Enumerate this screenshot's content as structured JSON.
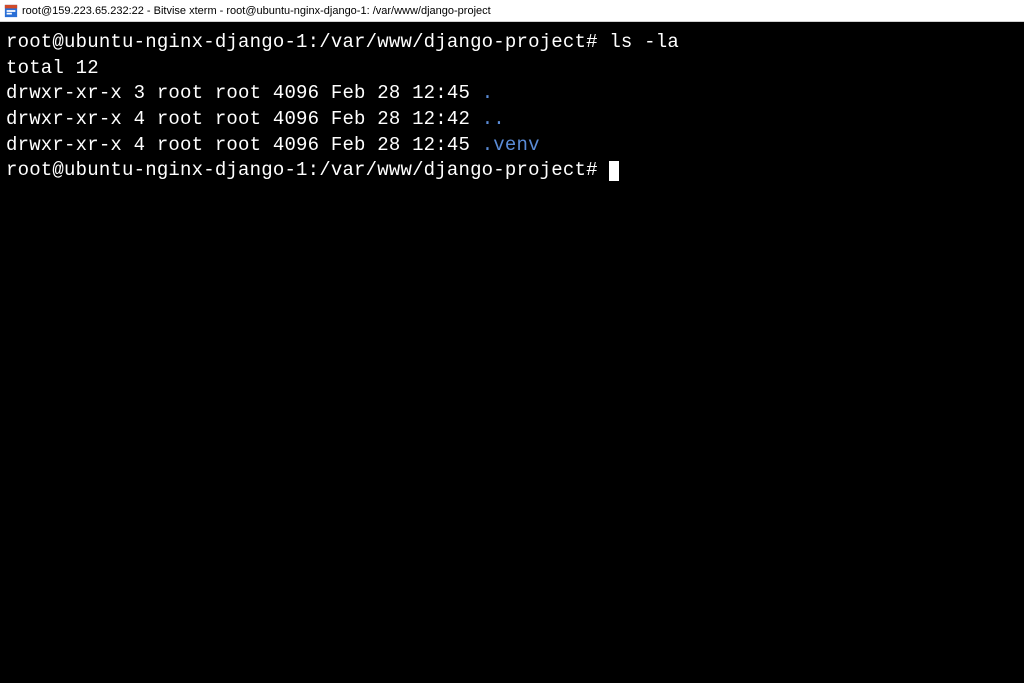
{
  "window": {
    "title": "root@159.223.65.232:22 - Bitvise xterm - root@ubuntu-nginx-django-1: /var/www/django-project"
  },
  "terminal": {
    "prompt": "root@ubuntu-nginx-django-1:/var/www/django-project#",
    "command": "ls -la",
    "total_line": "total 12",
    "listing": [
      {
        "perms": "drwxr-xr-x",
        "links": "3",
        "owner": "root",
        "group": "root",
        "size": "4096",
        "month": "Feb",
        "day": "28",
        "time": "12:45",
        "name": "."
      },
      {
        "perms": "drwxr-xr-x",
        "links": "4",
        "owner": "root",
        "group": "root",
        "size": "4096",
        "month": "Feb",
        "day": "28",
        "time": "12:42",
        "name": ".."
      },
      {
        "perms": "drwxr-xr-x",
        "links": "4",
        "owner": "root",
        "group": "root",
        "size": "4096",
        "month": "Feb",
        "day": "28",
        "time": "12:45",
        "name": ".venv"
      }
    ]
  }
}
